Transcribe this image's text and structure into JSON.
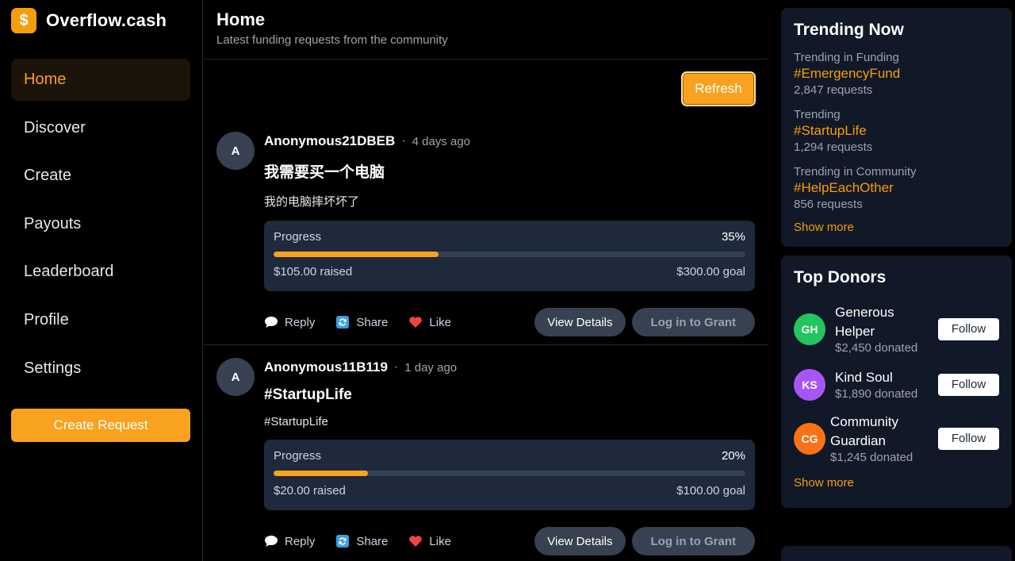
{
  "brand": {
    "logo_glyph": "$",
    "name": "Overflow.cash"
  },
  "nav": {
    "items": [
      {
        "label": "Home",
        "active": true
      },
      {
        "label": "Discover"
      },
      {
        "label": "Create"
      },
      {
        "label": "Payouts"
      },
      {
        "label": "Leaderboard"
      },
      {
        "label": "Profile"
      },
      {
        "label": "Settings"
      }
    ],
    "create_button": "Create Request"
  },
  "main": {
    "title": "Home",
    "subtitle": "Latest funding requests from the community",
    "refresh_label": "Refresh",
    "posts": [
      {
        "avatar": "A",
        "author": "Anonymous21DBEB",
        "separator": "·",
        "time": "4 days ago",
        "title": "我需要买一个电脑",
        "text": "我的电脑摔坏坏了",
        "progress_label": "Progress",
        "progress_pct": "35%",
        "progress_fraction": 0.35,
        "raised": "$105.00 raised",
        "goal": "$300.00 goal",
        "reply": "Reply",
        "share": "Share",
        "like": "Like",
        "details": "View Details",
        "grant": "Log in to Grant"
      },
      {
        "avatar": "A",
        "author": "Anonymous11B119",
        "separator": "·",
        "time": "1 day ago",
        "title": "#StartupLife",
        "text": "#StartupLife",
        "progress_label": "Progress",
        "progress_pct": "20%",
        "progress_fraction": 0.2,
        "raised": "$20.00 raised",
        "goal": "$100.00 goal",
        "reply": "Reply",
        "share": "Share",
        "like": "Like",
        "details": "View Details",
        "grant": "Log in to Grant"
      }
    ]
  },
  "trending": {
    "title": "Trending Now",
    "items": [
      {
        "category": "Trending in Funding",
        "tag": "#EmergencyFund",
        "count": "2,847 requests"
      },
      {
        "category": "Trending",
        "tag": "#StartupLife",
        "count": "1,294 requests"
      },
      {
        "category": "Trending in Community",
        "tag": "#HelpEachOther",
        "count": "856 requests"
      }
    ],
    "show_more": "Show more"
  },
  "donors": {
    "title": "Top Donors",
    "items": [
      {
        "initials": "GH",
        "name": "Generous Helper",
        "amount": "$2,450 donated",
        "color": "#22c55e",
        "follow": "Follow"
      },
      {
        "initials": "KS",
        "name": "Kind Soul",
        "amount": "$1,890 donated",
        "color": "#a855f7",
        "follow": "Follow"
      },
      {
        "initials": "CG",
        "name": "Community Guardian",
        "amount": "$1,245 donated",
        "color": "#f97316",
        "follow": "Follow"
      }
    ],
    "show_more": "Show more"
  },
  "colors": {
    "accent": "#f9a21f",
    "background": "#000000",
    "card": "#1e293b",
    "panel": "#111827"
  }
}
